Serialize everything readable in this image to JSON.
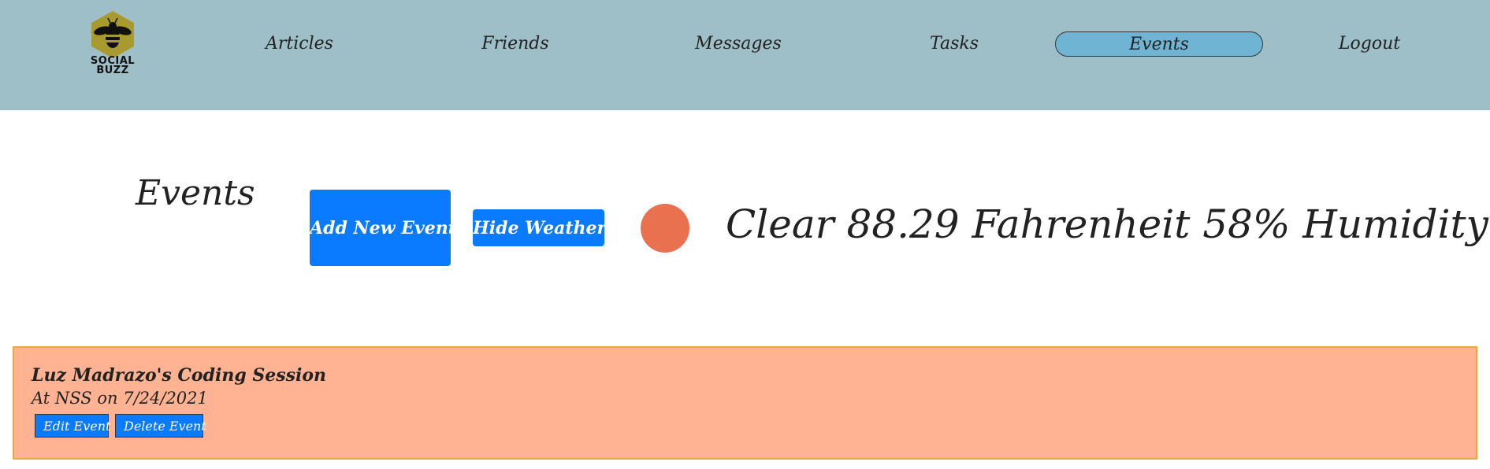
{
  "nav": {
    "logo_text": "SOCIAL\nBUZZ",
    "items": [
      {
        "label": "Articles"
      },
      {
        "label": "Friends"
      },
      {
        "label": "Messages"
      },
      {
        "label": "Tasks"
      },
      {
        "label": "Events",
        "active": true
      },
      {
        "label": "Logout"
      }
    ]
  },
  "page": {
    "title": "Events",
    "add_button": "Add New Event",
    "hide_weather_button": "Hide Weather"
  },
  "weather": {
    "icon": "weather-sun-icon",
    "summary": "Clear 88.29 Fahrenheit 58% Humidity"
  },
  "events": [
    {
      "name": "Luz Madrazo's Coding Session",
      "meta": "At NSS on 7/24/2021",
      "edit_label": "Edit Event",
      "delete_label": "Delete Event"
    }
  ],
  "colors": {
    "nav_bg": "#9fbfc8",
    "active_tab": "#6fb4d2",
    "button_blue": "#0a7bff",
    "weather_dot": "#ea7150",
    "event_bg": "#ffb392",
    "event_border": "#e9a93a"
  }
}
